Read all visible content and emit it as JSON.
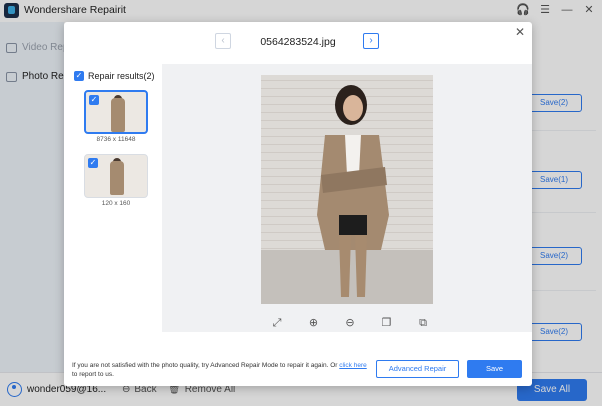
{
  "app": {
    "title": "Wondershare Repairit",
    "window_controls": [
      "headset-icon",
      "menu-icon",
      "minimize-icon",
      "close-icon"
    ]
  },
  "sidebar": {
    "items": [
      {
        "label": "Video Repair",
        "icon": "video-icon",
        "active": false
      },
      {
        "label": "Photo Repair",
        "icon": "photo-icon",
        "active": true
      }
    ]
  },
  "background_list": {
    "save_buttons": [
      "Save(2)",
      "Save(1)",
      "Save(2)",
      "Save(2)"
    ]
  },
  "bottom_bar": {
    "user": "wonder059@16...",
    "back_label": "Back",
    "remove_all_label": "Remove All",
    "save_all_label": "Save All"
  },
  "modal": {
    "file_name": "0564283524.jpg",
    "prev_icon": "‹",
    "next_icon": "›",
    "close_icon": "✕",
    "results_label": "Repair results(2)",
    "thumbnails": [
      {
        "label": "8736 x 11648",
        "selected": true
      },
      {
        "label": "120 x 160",
        "selected": false
      }
    ],
    "zoom_tools": [
      {
        "name": "fit-screen-icon",
        "glyph": "⤢"
      },
      {
        "name": "zoom-in-icon",
        "glyph": "⊕"
      },
      {
        "name": "zoom-out-icon",
        "glyph": "⊖"
      },
      {
        "name": "compare-icon",
        "glyph": "❐"
      },
      {
        "name": "copy-icon",
        "glyph": "⧉"
      }
    ],
    "footer_text": "If you are not satisfied with the photo quality, try Advanced Repair Mode to repair it again. Or",
    "footer_link": "click here",
    "footer_text_end": "to report to us.",
    "advanced_repair_label": "Advanced Repair",
    "save_label": "Save"
  },
  "colors": {
    "accent": "#2f7bf0",
    "sidebar_bg": "#eef3fa",
    "preview_bg": "#f0f1f3"
  }
}
